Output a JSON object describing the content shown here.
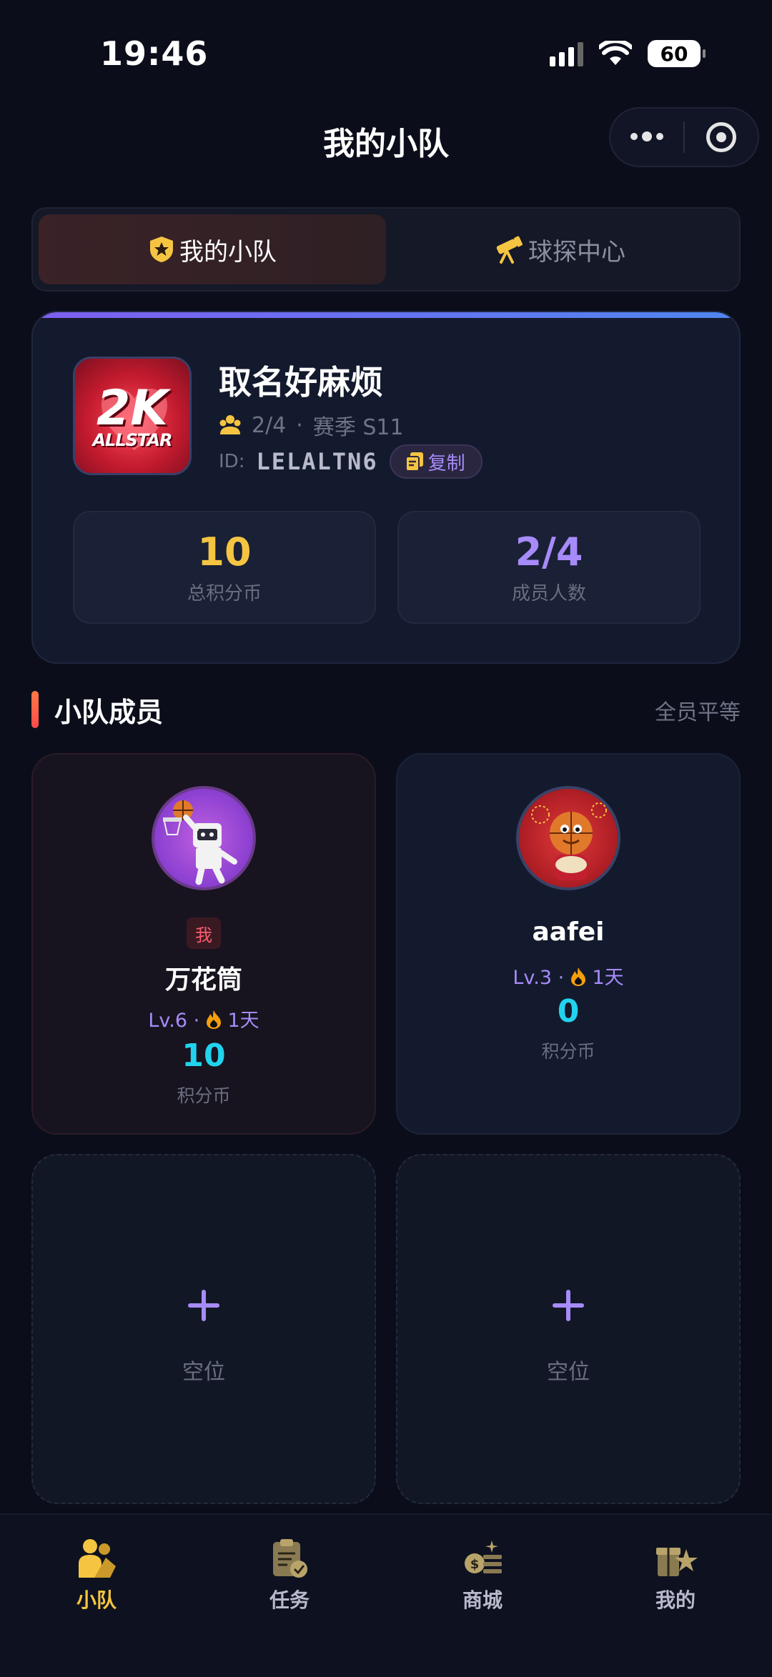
{
  "status_bar": {
    "time": "19:46",
    "battery": "60"
  },
  "header": {
    "title": "我的小队"
  },
  "tabs": [
    {
      "label": "我的小队",
      "icon": "shield-star-icon",
      "active": true
    },
    {
      "label": "球探中心",
      "icon": "telescope-icon",
      "active": false
    }
  ],
  "team": {
    "name": "取名好麻烦",
    "logo_text_main": "2K",
    "logo_text_sub": "ALLSTAR",
    "members_count": "2/4",
    "season": "赛季 S11",
    "id_label": "ID:",
    "id": "LELALTN6",
    "copy_label": "复制",
    "stats": [
      {
        "value": "10",
        "label": "总积分币",
        "color": "#f5c542"
      },
      {
        "value": "2/4",
        "label": "成员人数",
        "color": "#a78bfa"
      }
    ]
  },
  "members_section": {
    "title": "小队成员",
    "note": "全员平等"
  },
  "members": [
    {
      "name": "万花筒",
      "is_me": true,
      "me_badge": "我",
      "level": "Lv.6",
      "streak": "1天",
      "points": "10",
      "points_label": "积分币"
    },
    {
      "name": "aafei",
      "is_me": false,
      "level": "Lv.3",
      "streak": "1天",
      "points": "0",
      "points_label": "积分币"
    }
  ],
  "empty_slots": [
    {
      "label": "空位"
    },
    {
      "label": "空位"
    }
  ],
  "bottom_nav": [
    {
      "label": "小队",
      "icon": "team-icon",
      "active": true
    },
    {
      "label": "任务",
      "icon": "task-clipboard-icon",
      "active": false
    },
    {
      "label": "商城",
      "icon": "shop-coins-icon",
      "active": false
    },
    {
      "label": "我的",
      "icon": "profile-gift-icon",
      "active": false
    }
  ],
  "colors": {
    "accent_gold": "#f5c542",
    "accent_purple": "#a78bfa",
    "accent_cyan": "#22d3ee",
    "accent_red": "#ff5a6e"
  }
}
